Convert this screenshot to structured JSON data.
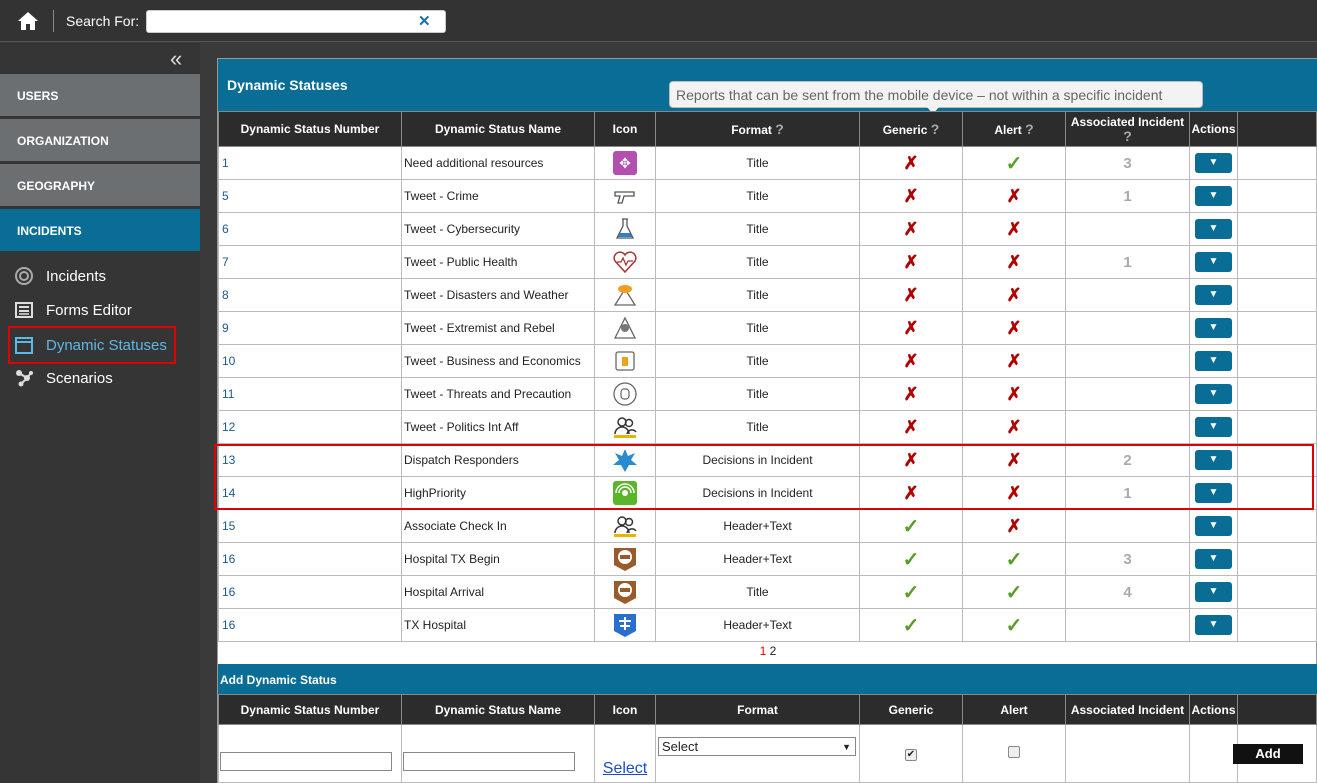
{
  "topbar": {
    "search_label": "Search For:",
    "search_value": "",
    "clear_glyph": "✕"
  },
  "sidebar": {
    "collapse_glyph": "«",
    "sections": [
      "USERS",
      "ORGANIZATION",
      "GEOGRAPHY",
      "INCIDENTS"
    ],
    "items": [
      {
        "label": "Incidents",
        "icon": "target-icon"
      },
      {
        "label": "Forms Editor",
        "icon": "list-icon"
      },
      {
        "label": "Dynamic Statuses",
        "icon": "calendar-icon"
      },
      {
        "label": "Scenarios",
        "icon": "network-icon"
      }
    ]
  },
  "panel": {
    "title": "Dynamic Statuses",
    "tooltip": "Reports that can be sent from the mobile device – not within a specific incident",
    "headers": {
      "number": "Dynamic Status Number",
      "name": "Dynamic Status Name",
      "icon": "Icon",
      "format": "Format",
      "generic": "Generic",
      "alert": "Alert",
      "assoc": "Associated Incident",
      "actions": "Actions"
    },
    "help_glyph": "?",
    "action_glyph": "▼",
    "rows": [
      {
        "num": "1",
        "name": "Need additional resources",
        "icon": "resources-icon",
        "format": "Title",
        "generic": "x",
        "alert": "check",
        "assoc": "3"
      },
      {
        "num": "5",
        "name": "Tweet - Crime",
        "icon": "gun-icon",
        "format": "Title",
        "generic": "x",
        "alert": "x",
        "assoc": "1"
      },
      {
        "num": "6",
        "name": "Tweet - Cybersecurity",
        "icon": "flask-icon",
        "format": "Title",
        "generic": "x",
        "alert": "x",
        "assoc": ""
      },
      {
        "num": "7",
        "name": "Tweet - Public Health",
        "icon": "heart-icon",
        "format": "Title",
        "generic": "x",
        "alert": "x",
        "assoc": "1"
      },
      {
        "num": "8",
        "name": "Tweet - Disasters and Weather",
        "icon": "weather-icon",
        "format": "Title",
        "generic": "x",
        "alert": "x",
        "assoc": ""
      },
      {
        "num": "9",
        "name": "Tweet - Extremist and Rebel",
        "icon": "spy-icon",
        "format": "Title",
        "generic": "x",
        "alert": "x",
        "assoc": ""
      },
      {
        "num": "10",
        "name": "Tweet - Business and Economics",
        "icon": "briefcase-icon",
        "format": "Title",
        "generic": "x",
        "alert": "x",
        "assoc": ""
      },
      {
        "num": "11",
        "name": "Tweet - Threats and Precaution",
        "icon": "hand-icon",
        "format": "Title",
        "generic": "x",
        "alert": "x",
        "assoc": ""
      },
      {
        "num": "12",
        "name": "Tweet - Politics Int Aff",
        "icon": "people-icon",
        "format": "Title",
        "generic": "x",
        "alert": "x",
        "assoc": ""
      },
      {
        "num": "13",
        "name": "Dispatch Responders",
        "icon": "explosion-icon",
        "format": "Decisions in Incident",
        "generic": "x",
        "alert": "x",
        "assoc": "2"
      },
      {
        "num": "14",
        "name": "HighPriority",
        "icon": "signal-icon",
        "format": "Decisions in Incident",
        "generic": "x",
        "alert": "x",
        "assoc": "1"
      },
      {
        "num": "15",
        "name": "Associate Check In",
        "icon": "people-icon",
        "format": "Header+Text",
        "generic": "check",
        "alert": "x",
        "assoc": ""
      },
      {
        "num": "16",
        "name": "Hospital TX Begin",
        "icon": "no-entry-icon",
        "format": "Header+Text",
        "generic": "check",
        "alert": "check",
        "assoc": "3"
      },
      {
        "num": "16",
        "name": "Hospital Arrival",
        "icon": "no-entry-icon",
        "format": "Title",
        "generic": "check",
        "alert": "check",
        "assoc": "4"
      },
      {
        "num": "16",
        "name": "TX Hospital",
        "icon": "hospital-icon",
        "format": "Header+Text",
        "generic": "check",
        "alert": "check",
        "assoc": ""
      }
    ],
    "pager": {
      "current": "1",
      "next": "2"
    }
  },
  "add_form": {
    "title": "Add Dynamic Status",
    "select_link": "Select",
    "format_value": "Select",
    "generic_checked": "✔",
    "add_label": "Add"
  }
}
